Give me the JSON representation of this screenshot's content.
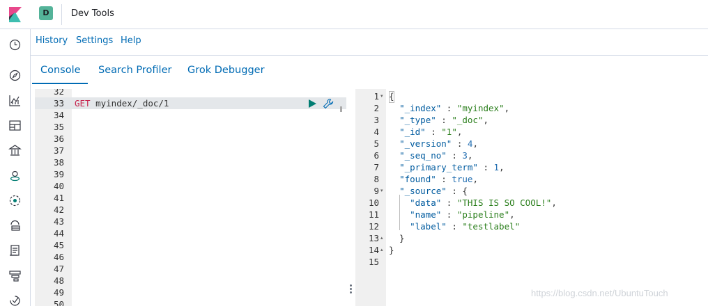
{
  "header": {
    "space_initial": "D",
    "app_title": "Dev Tools"
  },
  "menu": {
    "items": [
      {
        "label": "History"
      },
      {
        "label": "Settings"
      },
      {
        "label": "Help"
      }
    ]
  },
  "tabs": [
    {
      "label": "Console",
      "active": true
    },
    {
      "label": "Search Profiler",
      "active": false
    },
    {
      "label": "Grok Debugger",
      "active": false
    }
  ],
  "nav_icons": [
    "clock-icon",
    "compass-icon",
    "visualize-icon",
    "dashboard-icon",
    "canvas-icon",
    "maps-icon",
    "ml-icon",
    "infrastructure-icon",
    "logs-icon",
    "apm-icon",
    "uptime-icon"
  ],
  "request_editor": {
    "line_numbers": [
      "32",
      "33",
      "34",
      "35",
      "36",
      "37",
      "38",
      "39",
      "40",
      "41",
      "42",
      "43",
      "44",
      "45",
      "46",
      "47",
      "48",
      "49",
      "50"
    ],
    "active_line": "33",
    "method": "GET",
    "path": " myindex/_doc/1"
  },
  "response_editor": {
    "line_numbers": [
      "1",
      "2",
      "3",
      "4",
      "5",
      "6",
      "7",
      "8",
      "9",
      "10",
      "11",
      "12",
      "13",
      "14",
      "15"
    ],
    "lines": [
      "{",
      "  \"_index\" : \"myindex\",",
      "  \"_type\" : \"_doc\",",
      "  \"_id\" : \"1\",",
      "  \"_version\" : 4,",
      "  \"_seq_no\" : 3,",
      "  \"_primary_term\" : 1,",
      "  \"found\" : true,",
      "  \"_source\" : {",
      "    \"data\" : \"THIS IS SO COOL!\",",
      "    \"name\" : \"pipeline\",",
      "    \"label\" : \"testlabel\"",
      "  }",
      "}",
      ""
    ],
    "fold_markers": {
      "1": "▾",
      "9": "▾",
      "13": "▴",
      "14": "▴"
    }
  },
  "watermark": "https://blog.csdn.net/UbuntuTouch",
  "colors": {
    "link": "#006bb4",
    "space_badge": "#54b399",
    "gutter": "#f0f0f0",
    "active_line": "#e4e7ea",
    "method": "#c7254e",
    "string": "#2a7e1b",
    "key": "#005b9f"
  }
}
